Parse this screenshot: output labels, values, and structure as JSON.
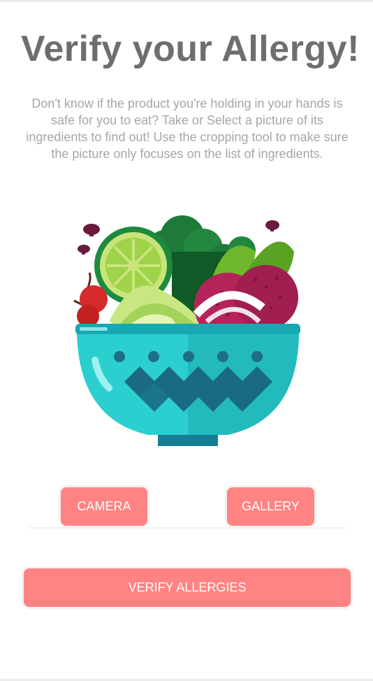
{
  "header": {
    "title": "Verify your Allergy!",
    "description": "Don't know if the product you're holding in your hands is safe for you to eat? Take or Select a picture of its ingredients to find out! Use the cropping tool to make sure the picture only focuses on the list of ingredients."
  },
  "illustration": {
    "icon": "salad-bowl-illustration"
  },
  "actions": {
    "camera_label": "CAMERA",
    "gallery_label": "GALLERY",
    "verify_label": "VERIFY ALLERGIES"
  },
  "colors": {
    "button": "#ff8382",
    "title": "#6e6e6e",
    "description": "#a6a6a6",
    "bowl": "#2ccfcf"
  }
}
